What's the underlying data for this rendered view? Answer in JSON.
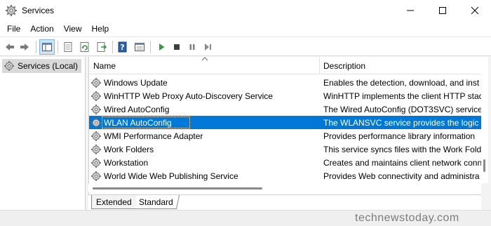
{
  "window": {
    "title": "Services",
    "icon": "services-gear-icon",
    "controls": [
      "minimize-icon",
      "maximize-icon",
      "close-icon"
    ]
  },
  "menu": [
    "File",
    "Action",
    "View",
    "Help"
  ],
  "toolbar": [
    "back-arrow-icon",
    "forward-arrow-icon",
    "show-hide-tree-icon",
    "properties-icon",
    "refresh-icon",
    "export-list-icon",
    "help-icon",
    "console-view-icon",
    "start-service-icon",
    "stop-service-icon",
    "pause-service-icon",
    "restart-service-icon"
  ],
  "tree": {
    "label": "Services (Local)"
  },
  "columns": {
    "name": "Name",
    "description": "Description"
  },
  "rows": [
    {
      "name": "Windows Update",
      "description": "Enables the detection, download, and inst"
    },
    {
      "name": "WinHTTP Web Proxy Auto-Discovery Service",
      "description": "WinHTTP implements the client HTTP stac"
    },
    {
      "name": "Wired AutoConfig",
      "description": "The Wired AutoConfig (DOT3SVC) service"
    },
    {
      "name": "WLAN AutoConfig",
      "description": "The WLANSVC service provides the logic n",
      "selected": true
    },
    {
      "name": "WMI Performance Adapter",
      "description": "Provides performance library information"
    },
    {
      "name": "Work Folders",
      "description": "This service syncs files with the Work Fold"
    },
    {
      "name": "Workstation",
      "description": "Creates and maintains client network conn"
    },
    {
      "name": "World Wide Web Publishing Service",
      "description": "Provides Web connectivity and administra"
    }
  ],
  "tabs": {
    "extended": "Extended",
    "standard": "Standard"
  },
  "watermark": "technewstoday.com",
  "colors": {
    "selection": "#0078d7",
    "accent_green": "#2e9e3e"
  }
}
